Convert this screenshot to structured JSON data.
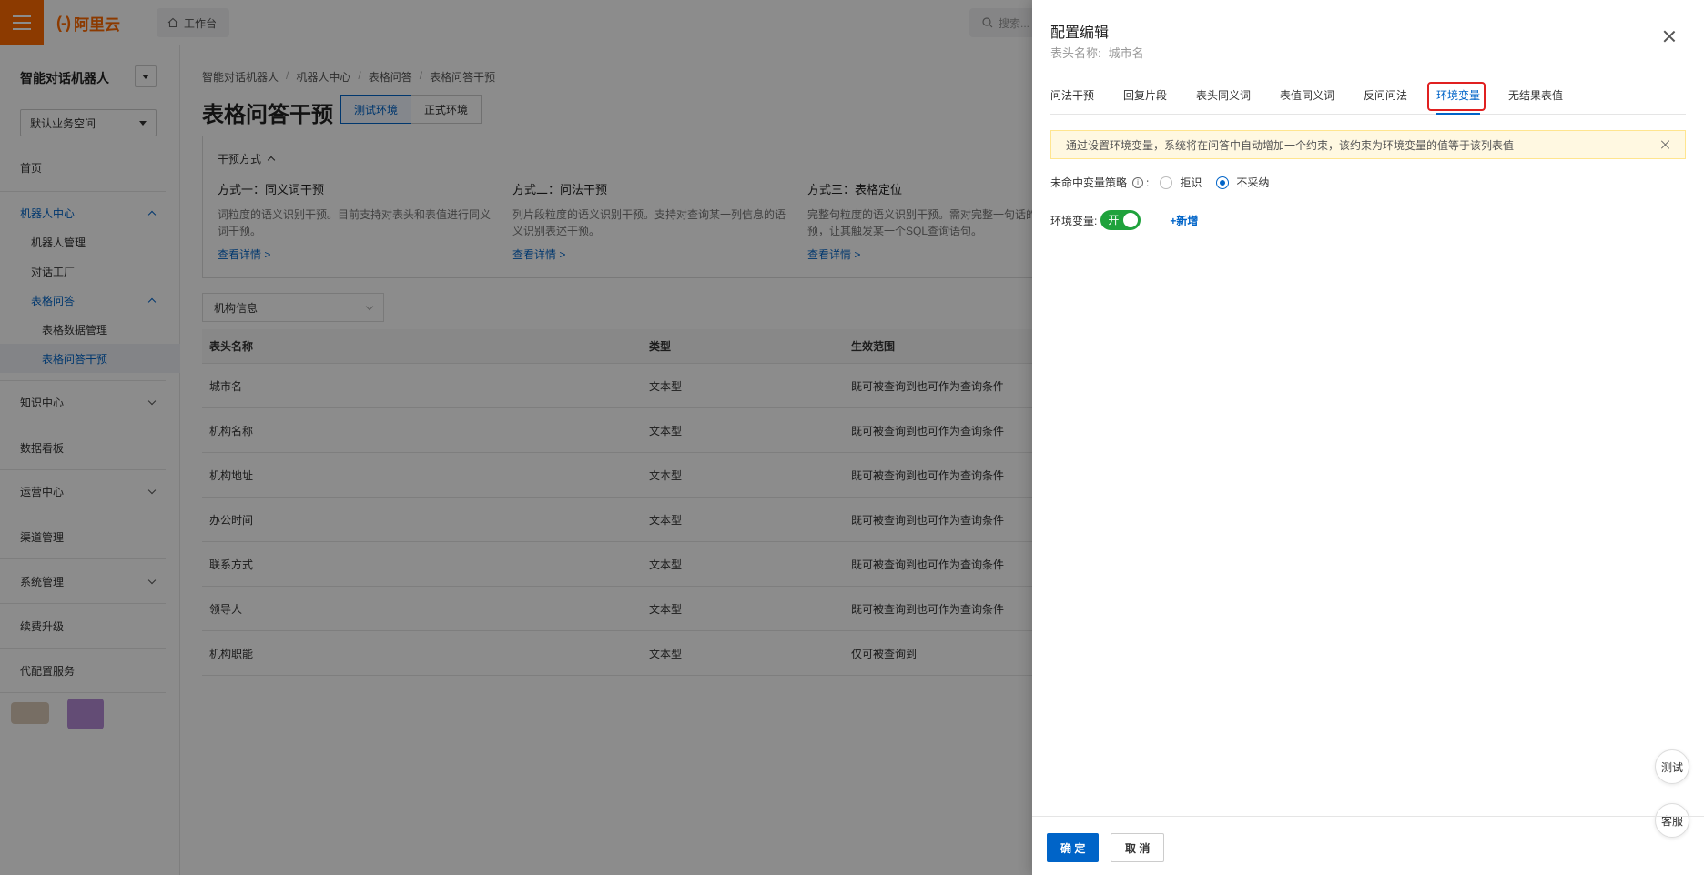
{
  "topbar": {
    "logo": "阿里云",
    "logo_mark": "(-)",
    "workbench": "工作台",
    "search_placeholder": "搜索..."
  },
  "sidebar": {
    "title": "智能对话机器人",
    "space": "默认业务空间",
    "items": [
      {
        "label": "首页"
      },
      {
        "label": "机器人中心"
      },
      {
        "label": "机器人管理"
      },
      {
        "label": "对话工厂"
      },
      {
        "label": "表格问答"
      },
      {
        "label": "表格数据管理"
      },
      {
        "label": "表格问答干预"
      },
      {
        "label": "知识中心"
      },
      {
        "label": "数据看板"
      },
      {
        "label": "运营中心"
      },
      {
        "label": "渠道管理"
      },
      {
        "label": "系统管理"
      },
      {
        "label": "续费升级"
      },
      {
        "label": "代配置服务"
      }
    ]
  },
  "breadcrumb": [
    "智能对话机器人",
    "机器人中心",
    "表格问答",
    "表格问答干预"
  ],
  "page": {
    "title": "表格问答干预",
    "env_test": "测试环境",
    "env_prod": "正式环境"
  },
  "intervene": {
    "heading": "干预方式",
    "cols": [
      {
        "title": "方式一：同义词干预",
        "desc": "词粒度的语义识别干预。目前支持对表头和表值进行同义词干预。",
        "link": "查看详情 >"
      },
      {
        "title": "方式二：问法干预",
        "desc": "列片段粒度的语义识别干预。支持对查询某一列信息的语义识别表述干预。",
        "link": "查看详情 >"
      },
      {
        "title": "方式三：表格定位",
        "desc": "完整句粒度的语义识别干预。需对完整一句话的问法干预，让其触发某一个SQL查询语句。",
        "link": "查看详情 >"
      }
    ]
  },
  "filter": {
    "value": "机构信息"
  },
  "table": {
    "headers": [
      "表头名称",
      "类型",
      "生效范围"
    ],
    "rows": [
      [
        "城市名",
        "文本型",
        "既可被查询到也可作为查询条件"
      ],
      [
        "机构名称",
        "文本型",
        "既可被查询到也可作为查询条件"
      ],
      [
        "机构地址",
        "文本型",
        "既可被查询到也可作为查询条件"
      ],
      [
        "办公时间",
        "文本型",
        "既可被查询到也可作为查询条件"
      ],
      [
        "联系方式",
        "文本型",
        "既可被查询到也可作为查询条件"
      ],
      [
        "领导人",
        "文本型",
        "既可被查询到也可作为查询条件"
      ],
      [
        "机构职能",
        "文本型",
        "仅可被查询到"
      ]
    ]
  },
  "drawer": {
    "title": "配置编辑",
    "sub_label": "表头名称:",
    "sub_value": "城市名",
    "tabs": [
      "问法干预",
      "回复片段",
      "表头同义词",
      "表值同义词",
      "反问问法",
      "环境变量",
      "无结果表值"
    ],
    "active_tab": "环境变量",
    "notice": "通过设置环境变量，系统将在问答中自动增加一个约束，该约束为环境变量的值等于该列表值",
    "strategy_label": "未命中变量策略",
    "strategy_colon": ":",
    "info_glyph": "i",
    "radio_reject": "拒识",
    "radio_ignore": "不采纳",
    "envvar_label": "环境变量:",
    "switch_label": "开",
    "add_label": "+新增",
    "confirm": "确 定",
    "cancel": "取 消"
  },
  "floating": {
    "test": "测试",
    "service": "客服"
  },
  "colors": {
    "brand": "#ff6a00",
    "primary": "#0064c8",
    "switch_on": "#1fa23c",
    "highlight": "#e02020"
  }
}
